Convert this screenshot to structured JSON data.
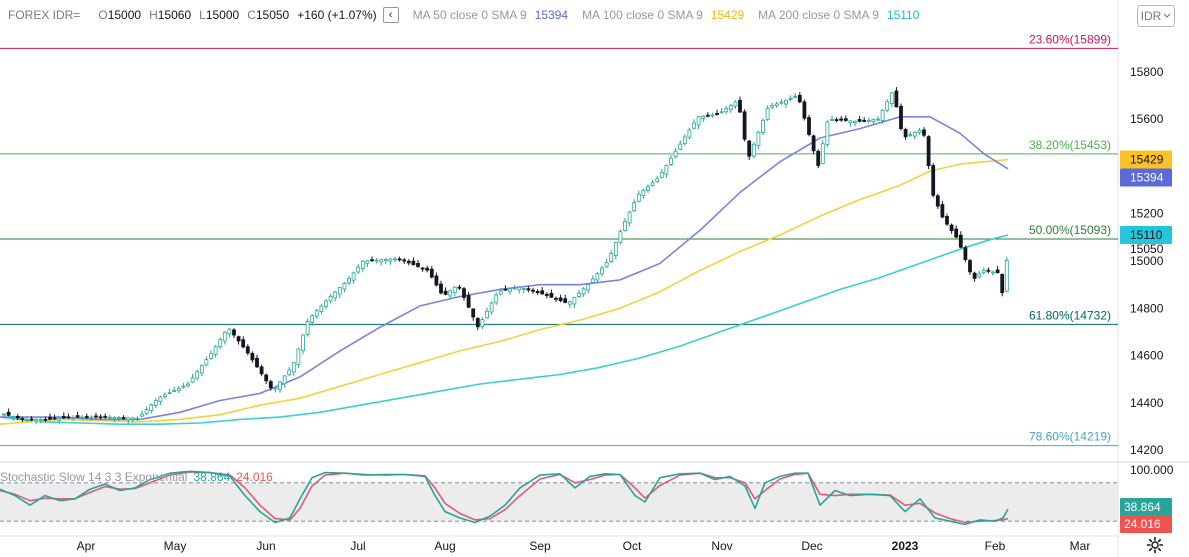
{
  "header": {
    "symbol": "FOREX IDR=",
    "o_label": "O",
    "o_value": "15000",
    "h_label": "H",
    "h_value": "15060",
    "l_label": "L",
    "l_value": "15000",
    "c_label": "C",
    "c_value": "15050",
    "change": "+160 (+1.07%)",
    "collapse_glyph": "‹",
    "ma50_label": "MA 50 close 0 SMA 9",
    "ma50_value": "15394",
    "ma100_label": "MA 100 close 0 SMA 9",
    "ma100_value": "15429",
    "ma200_label": "MA 200 close 0 SMA 9",
    "ma200_value": "15110"
  },
  "currency_select": {
    "value": "IDR",
    "icon": "chevron-down-icon"
  },
  "stoch_label": {
    "name": "Stochastic Slow 14 3 3 Exponential",
    "k_value": "38.864",
    "d_value": "24.016"
  },
  "colors": {
    "up": "#26a69a",
    "down": "#131722",
    "ma50": "#7b83e0",
    "ma100": "#f5d142",
    "ma200": "#3ccfcf",
    "fib_236": "#c2185b",
    "fib_382": "#4caf50",
    "fib_50": "#2e7d32",
    "fib_618": "#00695c",
    "fib_786": "#4aa3c7",
    "stoch_k": "#26a69a",
    "stoch_d": "#e05a7a",
    "stoch_band": "#ececec"
  },
  "chart_data": {
    "type": "candlestick",
    "y_axis": {
      "range": [
        14150,
        15960
      ],
      "ticks": [
        14200,
        14400,
        14600,
        14800,
        15000,
        15200,
        15400,
        15600,
        15800
      ]
    },
    "x_axis": {
      "labels": [
        "Apr",
        "May",
        "Jun",
        "Jul",
        "Aug",
        "Sep",
        "Oct",
        "Nov",
        "Dec",
        "2023",
        "Feb",
        "Mar"
      ]
    },
    "fib_levels": [
      {
        "label": "23.60%(15899)",
        "value": 15899,
        "color_key": "fib_236"
      },
      {
        "label": "38.20%(15453)",
        "value": 15453,
        "color_key": "fib_382"
      },
      {
        "label": "50.00%(15093)",
        "value": 15093,
        "color_key": "fib_50"
      },
      {
        "label": "61.80%(14732)",
        "value": 14732,
        "color_key": "fib_618"
      },
      {
        "label": "78.60%(14219)",
        "value": 14219,
        "color_key": "fib_786"
      }
    ],
    "price_badges": [
      {
        "label": "15429",
        "value": 15429,
        "bg": "#f9c229",
        "fg": "#131722"
      },
      {
        "label": "15394",
        "value": 15394,
        "bg": "#5b6ad6",
        "fg": "#ffffff"
      },
      {
        "label": "15110",
        "value": 15110,
        "bg": "#26c6da",
        "fg": "#131722"
      },
      {
        "label": "15050",
        "value": 15050,
        "bg": "",
        "fg": "#131722"
      }
    ],
    "close_path": [
      [
        0,
        14360
      ],
      [
        25,
        14330
      ],
      [
        50,
        14330
      ],
      [
        80,
        14340
      ],
      [
        110,
        14340
      ],
      [
        140,
        14335
      ],
      [
        160,
        14420
      ],
      [
        190,
        14480
      ],
      [
        215,
        14620
      ],
      [
        230,
        14720
      ],
      [
        250,
        14610
      ],
      [
        275,
        14450
      ],
      [
        295,
        14560
      ],
      [
        310,
        14750
      ],
      [
        330,
        14840
      ],
      [
        350,
        14920
      ],
      [
        365,
        15000
      ],
      [
        400,
        15010
      ],
      [
        430,
        14960
      ],
      [
        445,
        14850
      ],
      [
        460,
        14900
      ],
      [
        480,
        14720
      ],
      [
        500,
        14870
      ],
      [
        520,
        14890
      ],
      [
        545,
        14860
      ],
      [
        570,
        14820
      ],
      [
        590,
        14900
      ],
      [
        610,
        15000
      ],
      [
        625,
        15150
      ],
      [
        640,
        15280
      ],
      [
        660,
        15350
      ],
      [
        680,
        15480
      ],
      [
        700,
        15610
      ],
      [
        720,
        15620
      ],
      [
        740,
        15680
      ],
      [
        750,
        15430
      ],
      [
        770,
        15650
      ],
      [
        800,
        15700
      ],
      [
        820,
        15400
      ],
      [
        830,
        15600
      ],
      [
        860,
        15590
      ],
      [
        880,
        15600
      ],
      [
        895,
        15720
      ],
      [
        905,
        15520
      ],
      [
        925,
        15560
      ],
      [
        935,
        15280
      ],
      [
        945,
        15180
      ],
      [
        960,
        15090
      ],
      [
        975,
        14920
      ],
      [
        985,
        14960
      ],
      [
        1000,
        14950
      ],
      [
        1005,
        14850
      ],
      [
        1010,
        15050
      ]
    ],
    "ma50": [
      [
        0,
        14340
      ],
      [
        60,
        14340
      ],
      [
        100,
        14330
      ],
      [
        140,
        14330
      ],
      [
        180,
        14360
      ],
      [
        220,
        14410
      ],
      [
        260,
        14440
      ],
      [
        300,
        14510
      ],
      [
        340,
        14620
      ],
      [
        380,
        14720
      ],
      [
        420,
        14810
      ],
      [
        460,
        14850
      ],
      [
        500,
        14880
      ],
      [
        540,
        14900
      ],
      [
        580,
        14900
      ],
      [
        620,
        14920
      ],
      [
        660,
        14990
      ],
      [
        700,
        15130
      ],
      [
        740,
        15290
      ],
      [
        780,
        15420
      ],
      [
        820,
        15520
      ],
      [
        860,
        15560
      ],
      [
        900,
        15610
      ],
      [
        930,
        15610
      ],
      [
        960,
        15540
      ],
      [
        985,
        15450
      ],
      [
        1008,
        15390
      ]
    ],
    "ma100": [
      [
        0,
        14310
      ],
      [
        60,
        14330
      ],
      [
        100,
        14325
      ],
      [
        140,
        14320
      ],
      [
        180,
        14330
      ],
      [
        220,
        14350
      ],
      [
        260,
        14390
      ],
      [
        300,
        14420
      ],
      [
        340,
        14470
      ],
      [
        380,
        14520
      ],
      [
        420,
        14570
      ],
      [
        460,
        14620
      ],
      [
        500,
        14660
      ],
      [
        540,
        14710
      ],
      [
        580,
        14750
      ],
      [
        620,
        14800
      ],
      [
        660,
        14870
      ],
      [
        700,
        14960
      ],
      [
        740,
        15040
      ],
      [
        780,
        15110
      ],
      [
        820,
        15190
      ],
      [
        860,
        15260
      ],
      [
        900,
        15320
      ],
      [
        930,
        15380
      ],
      [
        960,
        15410
      ],
      [
        985,
        15420
      ],
      [
        1008,
        15429
      ]
    ],
    "ma200": [
      [
        0,
        14340
      ],
      [
        40,
        14320
      ],
      [
        80,
        14315
      ],
      [
        120,
        14310
      ],
      [
        160,
        14310
      ],
      [
        200,
        14315
      ],
      [
        240,
        14330
      ],
      [
        280,
        14340
      ],
      [
        320,
        14360
      ],
      [
        360,
        14390
      ],
      [
        400,
        14420
      ],
      [
        440,
        14450
      ],
      [
        480,
        14480
      ],
      [
        520,
        14500
      ],
      [
        560,
        14520
      ],
      [
        600,
        14550
      ],
      [
        640,
        14590
      ],
      [
        680,
        14640
      ],
      [
        720,
        14700
      ],
      [
        760,
        14760
      ],
      [
        800,
        14820
      ],
      [
        840,
        14880
      ],
      [
        880,
        14930
      ],
      [
        920,
        14990
      ],
      [
        960,
        15050
      ],
      [
        990,
        15090
      ],
      [
        1008,
        15110
      ]
    ],
    "stochastic": {
      "y_range": [
        0,
        100
      ],
      "upper_band": 80,
      "lower_band": 20,
      "axis_label": "100.000",
      "k_badge": {
        "label": "38.864",
        "value": 38.864,
        "bg": "#26a69a",
        "fg": "#ffffff"
      },
      "d_badge": {
        "label": "24.016",
        "value": 24.016,
        "bg": "#ef5350",
        "fg": "#ffffff"
      },
      "k": [
        [
          0,
          70
        ],
        [
          15,
          60
        ],
        [
          30,
          45
        ],
        [
          45,
          60
        ],
        [
          60,
          52
        ],
        [
          75,
          55
        ],
        [
          90,
          70
        ],
        [
          105,
          78
        ],
        [
          120,
          68
        ],
        [
          135,
          72
        ],
        [
          150,
          85
        ],
        [
          170,
          95
        ],
        [
          190,
          98
        ],
        [
          210,
          96
        ],
        [
          230,
          90
        ],
        [
          245,
          60
        ],
        [
          260,
          35
        ],
        [
          275,
          18
        ],
        [
          290,
          25
        ],
        [
          300,
          55
        ],
        [
          312,
          88
        ],
        [
          325,
          96
        ],
        [
          345,
          95
        ],
        [
          365,
          92
        ],
        [
          385,
          93
        ],
        [
          405,
          93
        ],
        [
          425,
          90
        ],
        [
          435,
          60
        ],
        [
          445,
          35
        ],
        [
          460,
          25
        ],
        [
          475,
          18
        ],
        [
          490,
          28
        ],
        [
          505,
          45
        ],
        [
          520,
          72
        ],
        [
          540,
          92
        ],
        [
          560,
          94
        ],
        [
          575,
          72
        ],
        [
          590,
          90
        ],
        [
          605,
          94
        ],
        [
          620,
          93
        ],
        [
          635,
          60
        ],
        [
          645,
          50
        ],
        [
          660,
          88
        ],
        [
          680,
          94
        ],
        [
          700,
          95
        ],
        [
          715,
          85
        ],
        [
          730,
          90
        ],
        [
          745,
          75
        ],
        [
          755,
          40
        ],
        [
          765,
          80
        ],
        [
          780,
          90
        ],
        [
          795,
          95
        ],
        [
          808,
          95
        ],
        [
          820,
          45
        ],
        [
          835,
          68
        ],
        [
          850,
          60
        ],
        [
          870,
          62
        ],
        [
          890,
          60
        ],
        [
          905,
          35
        ],
        [
          920,
          55
        ],
        [
          935,
          25
        ],
        [
          950,
          20
        ],
        [
          965,
          15
        ],
        [
          980,
          22
        ],
        [
          995,
          20
        ],
        [
          1003,
          25
        ],
        [
          1008,
          38.864
        ]
      ],
      "d": [
        [
          0,
          68
        ],
        [
          15,
          62
        ],
        [
          30,
          52
        ],
        [
          45,
          56
        ],
        [
          60,
          55
        ],
        [
          75,
          55
        ],
        [
          90,
          65
        ],
        [
          105,
          74
        ],
        [
          120,
          70
        ],
        [
          135,
          71
        ],
        [
          150,
          80
        ],
        [
          170,
          92
        ],
        [
          190,
          97
        ],
        [
          210,
          96
        ],
        [
          230,
          92
        ],
        [
          245,
          72
        ],
        [
          260,
          45
        ],
        [
          275,
          24
        ],
        [
          290,
          22
        ],
        [
          300,
          40
        ],
        [
          312,
          75
        ],
        [
          325,
          92
        ],
        [
          345,
          95
        ],
        [
          365,
          93
        ],
        [
          385,
          92
        ],
        [
          405,
          93
        ],
        [
          425,
          91
        ],
        [
          435,
          72
        ],
        [
          445,
          48
        ],
        [
          460,
          32
        ],
        [
          475,
          22
        ],
        [
          490,
          24
        ],
        [
          505,
          38
        ],
        [
          520,
          60
        ],
        [
          540,
          86
        ],
        [
          560,
          93
        ],
        [
          575,
          80
        ],
        [
          590,
          85
        ],
        [
          605,
          92
        ],
        [
          620,
          93
        ],
        [
          635,
          72
        ],
        [
          645,
          56
        ],
        [
          660,
          76
        ],
        [
          680,
          92
        ],
        [
          700,
          95
        ],
        [
          715,
          88
        ],
        [
          730,
          88
        ],
        [
          745,
          80
        ],
        [
          755,
          55
        ],
        [
          765,
          68
        ],
        [
          780,
          86
        ],
        [
          795,
          93
        ],
        [
          808,
          95
        ],
        [
          820,
          62
        ],
        [
          835,
          60
        ],
        [
          850,
          62
        ],
        [
          870,
          62
        ],
        [
          890,
          61
        ],
        [
          905,
          45
        ],
        [
          920,
          48
        ],
        [
          935,
          33
        ],
        [
          950,
          24
        ],
        [
          965,
          18
        ],
        [
          980,
          20
        ],
        [
          995,
          21
        ],
        [
          1003,
          22
        ],
        [
          1008,
          24.016
        ]
      ]
    }
  }
}
